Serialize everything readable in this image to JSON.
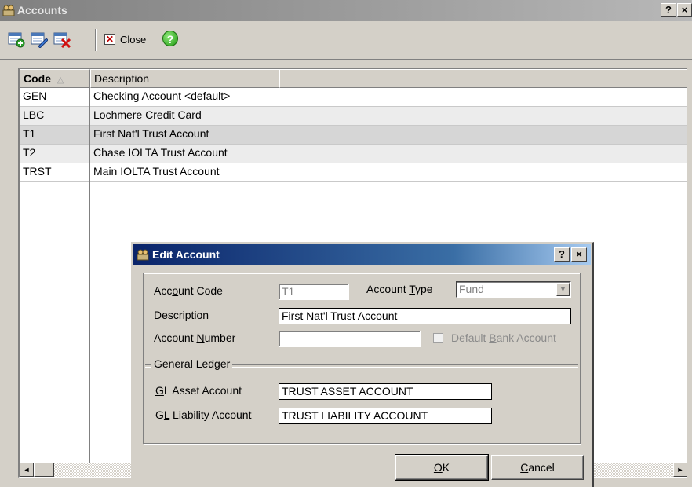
{
  "window": {
    "title": "Accounts",
    "help_btn": "?",
    "close_btn": "×"
  },
  "toolbar": {
    "add_icon": "add-record-icon",
    "edit_icon": "edit-record-icon",
    "delete_icon": "delete-record-icon",
    "close_label": "Close",
    "help_glyph": "?"
  },
  "grid": {
    "columns": [
      "Code",
      "Description",
      ""
    ],
    "sort_indicator": "△",
    "rows": [
      {
        "code": "GEN",
        "description": "Checking Account <default>"
      },
      {
        "code": "LBC",
        "description": "Lochmere Credit Card"
      },
      {
        "code": "T1",
        "description": "First Nat'l Trust Account"
      },
      {
        "code": "T2",
        "description": "Chase IOLTA Trust Account"
      },
      {
        "code": "TRST",
        "description": "Main IOLTA Trust Account"
      }
    ],
    "scroll_left": "◄",
    "scroll_right": "►"
  },
  "dialog": {
    "title": "Edit Account",
    "help_btn": "?",
    "close_btn": "×",
    "account_code_label_pre": "Acc",
    "account_code_label_u": "o",
    "account_code_label_post": "unt Code",
    "account_code_value": "T1",
    "account_type_label_pre": "Account ",
    "account_type_label_u": "T",
    "account_type_label_post": "ype",
    "account_type_value": "Fund",
    "dropdown_arrow": "▼",
    "description_label_pre": "D",
    "description_label_u": "e",
    "description_label_post": "scription",
    "description_value": "First Nat'l Trust Account",
    "account_number_label_pre": "Account ",
    "account_number_label_u": "N",
    "account_number_label_post": "umber",
    "account_number_value": "",
    "default_bank_pre": "Default ",
    "default_bank_u": "B",
    "default_bank_post": "ank Account",
    "group_label": "General Ledger",
    "gl_asset_label_u": "G",
    "gl_asset_label_post": "L Asset Account",
    "gl_asset_value": "TRUST ASSET ACCOUNT",
    "gl_liability_label_pre": "G",
    "gl_liability_label_u": "L",
    "gl_liability_label_post": " Liability Account",
    "gl_liability_value": "TRUST LIABILITY ACCOUNT",
    "ok_u": "O",
    "ok_post": "K",
    "cancel_u": "C",
    "cancel_post": "ancel"
  }
}
